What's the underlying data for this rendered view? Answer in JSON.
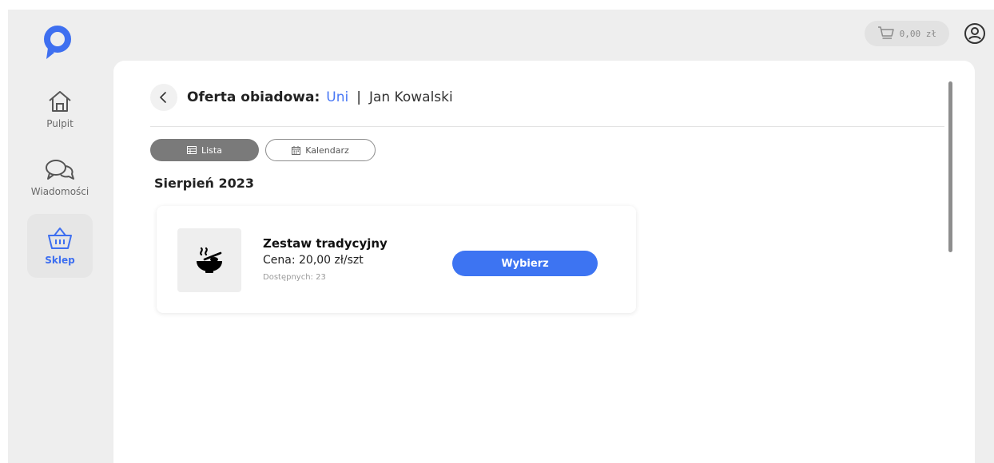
{
  "topbar": {
    "cart_amount": "0,00 zł"
  },
  "sidebar": {
    "items": [
      {
        "label": "Pulpit",
        "icon": "home-icon"
      },
      {
        "label": "Wiadomości",
        "icon": "chat-icon"
      },
      {
        "label": "Sklep",
        "icon": "basket-icon",
        "active": true
      }
    ]
  },
  "header": {
    "title": "Oferta obiadowa:",
    "school": "Uni",
    "separator": "|",
    "student": "Jan Kowalski"
  },
  "view_toggle": {
    "list_label": "Lista",
    "calendar_label": "Kalendarz",
    "selected": "Lista"
  },
  "month": "Sierpień 2023",
  "product": {
    "name": "Zestaw tradycyjny",
    "price": "Cena: 20,00 zł/szt",
    "stock": "Dostępnych: 23",
    "button": "Wybierz",
    "icon": "bowl-icon"
  },
  "colors": {
    "accent": "#3d74f2",
    "link": "#4a79f5",
    "toggle_active": "#7a7a7a"
  }
}
